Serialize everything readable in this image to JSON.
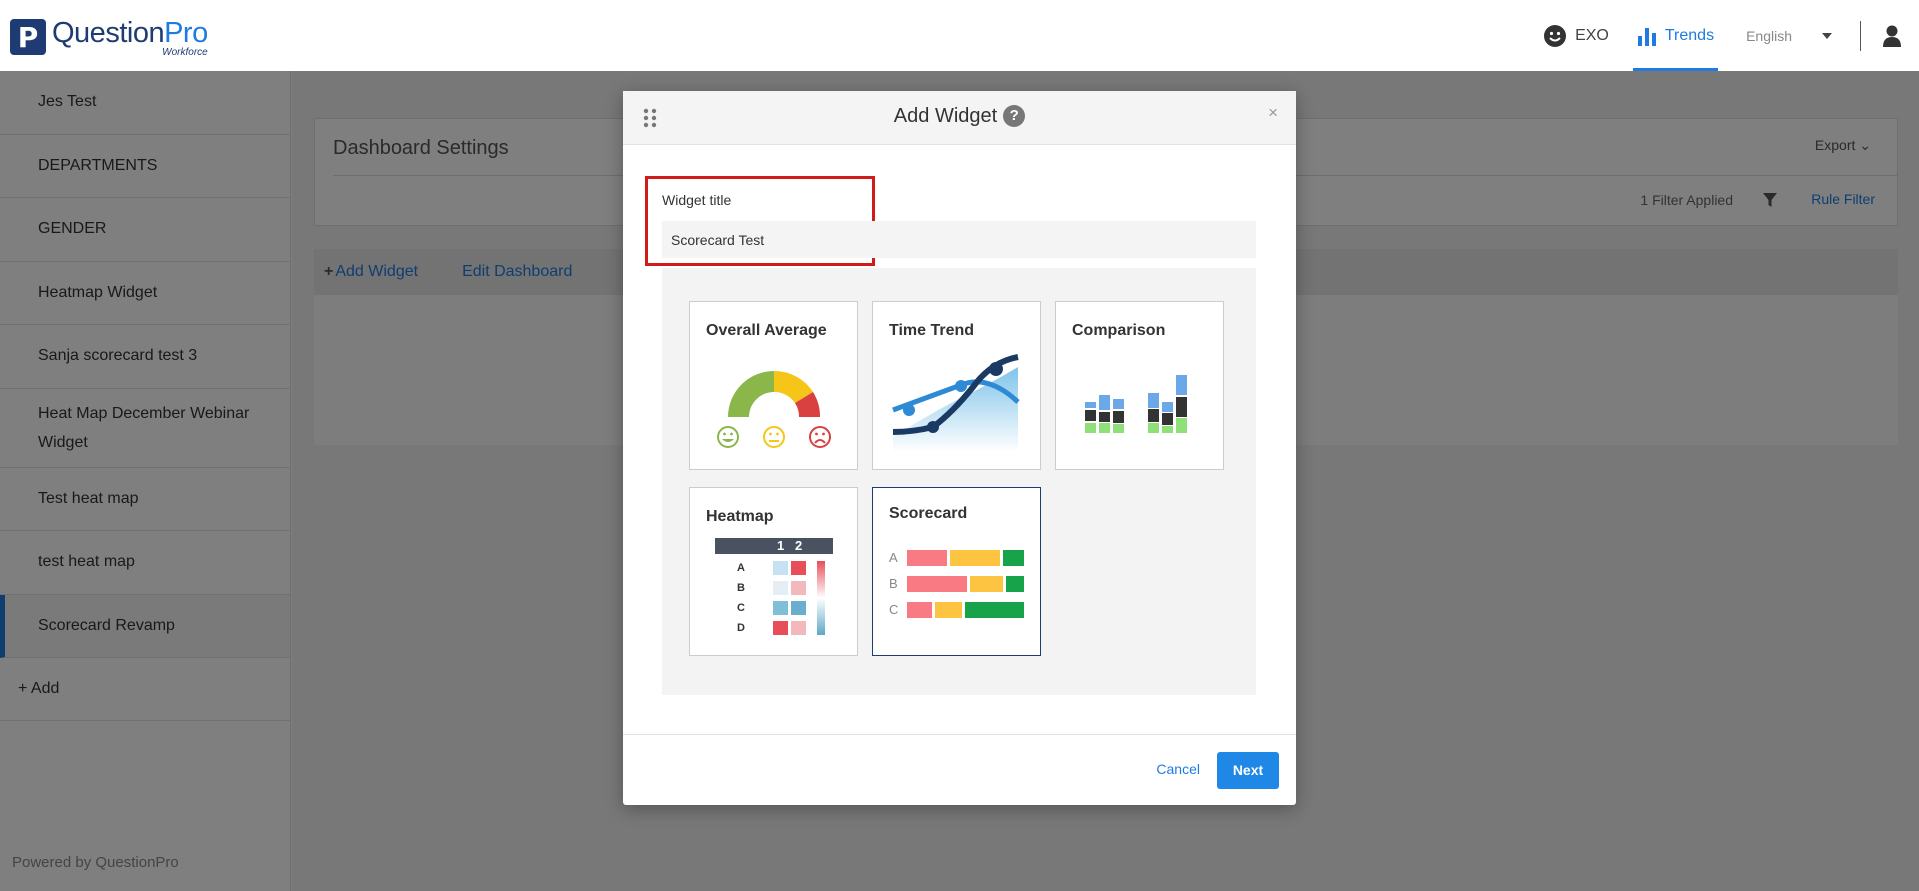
{
  "header": {
    "logo_mark": "P",
    "logo_name_a": "Question",
    "logo_name_b": "Pro",
    "logo_sub": "Workforce",
    "exo_label": "EXO",
    "trends_label": "Trends",
    "language": "English"
  },
  "sidebar": {
    "items": [
      {
        "label": "Jes Test"
      },
      {
        "label": "DEPARTMENTS"
      },
      {
        "label": "GENDER"
      },
      {
        "label": "Heatmap Widget"
      },
      {
        "label": "Sanja scorecard test 3"
      },
      {
        "label": "Heat Map December Webinar Widget"
      },
      {
        "label": "Test heat map"
      },
      {
        "label": "test heat map"
      },
      {
        "label": "Scorecard Revamp"
      }
    ],
    "add_label": "+ Add",
    "powered_by": "Powered by QuestionPro"
  },
  "dashboard": {
    "settings_title": "Dashboard Settings",
    "export_label": "Export",
    "filters_applied": "1 Filter Applied",
    "rule_filter_label": "Rule Filter",
    "add_widget_label": "Add Widget",
    "edit_dashboard_label": "Edit Dashboard"
  },
  "modal": {
    "title": "Add Widget",
    "help_glyph": "?",
    "close_glyph": "×",
    "widget_title_label": "Widget title",
    "widget_title_value": "Scorecard Test",
    "widget_types": [
      {
        "label": "Overall Average",
        "icon": "gauge-icon"
      },
      {
        "label": "Time Trend",
        "icon": "trend-line-icon"
      },
      {
        "label": "Comparison",
        "icon": "comparison-bars-icon"
      },
      {
        "label": "Heatmap",
        "icon": "heatmap-icon"
      },
      {
        "label": "Scorecard",
        "icon": "scorecard-icon",
        "selected": true
      }
    ],
    "heatmap_cols": [
      "1",
      "2"
    ],
    "heatmap_rows": [
      "A",
      "B",
      "C",
      "D"
    ],
    "scorecard_rows": [
      "A",
      "B",
      "C"
    ],
    "cancel_label": "Cancel",
    "next_label": "Next"
  },
  "colors": {
    "accent": "#1f7be0",
    "brand": "#1f3b73",
    "highlight": "#d11a1a",
    "gauge_green": "#8bb74a",
    "gauge_yellow": "#f5c518",
    "gauge_red": "#d94040"
  }
}
